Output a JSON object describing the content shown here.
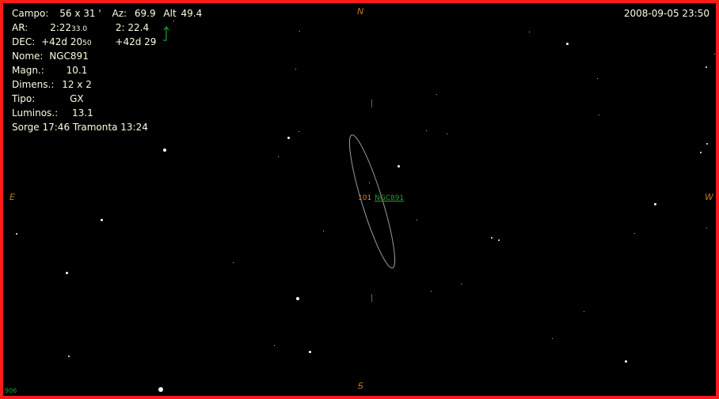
{
  "header": {
    "campo_label": "Campo:",
    "campo_value": "56  x   31 '",
    "az_label": "Az:",
    "az_value": "69.9",
    "alt_label": "Alt",
    "alt_value": "49.4",
    "datetime": "2008-09-05  23:50"
  },
  "coords": {
    "ar_label": "AR:",
    "ar_main": "2:22",
    "ar_small": "33.0",
    "ar_alt": "2: 22.4",
    "dec_label": "DEC:",
    "dec_main": "+42d 20",
    "dec_small": "50",
    "dec_alt": "+42d 29"
  },
  "object": {
    "nome_label": "Nome:",
    "nome_value": "NGC891",
    "magn_label": "Magn.:",
    "magn_value": "10.1",
    "dimens_label": "Dimens.:",
    "dimens_value": "12 x 2",
    "tipo_label": "Tipo:",
    "tipo_value": "GX",
    "lumin_label": "Luminos.:",
    "lumin_value": "13.1",
    "rise_set": "Sorge 17:46  Tramonta 13:24"
  },
  "map": {
    "north": "N",
    "south": "S",
    "east": "E",
    "west": "W",
    "object_magnitude_label": "101",
    "object_name_label": "NGC891",
    "corner_label": "906"
  },
  "colors": {
    "frame": "#ff1a1a",
    "info_text": "#fffbe0",
    "cardinal": "#c27b16",
    "marker_green": "#1fa02a",
    "ellipse": "#9a9a9a",
    "background": "#000000"
  },
  "icons": {
    "north_arrow": "up-arrow-icon",
    "galaxy_outline": "ellipse-outline"
  }
}
